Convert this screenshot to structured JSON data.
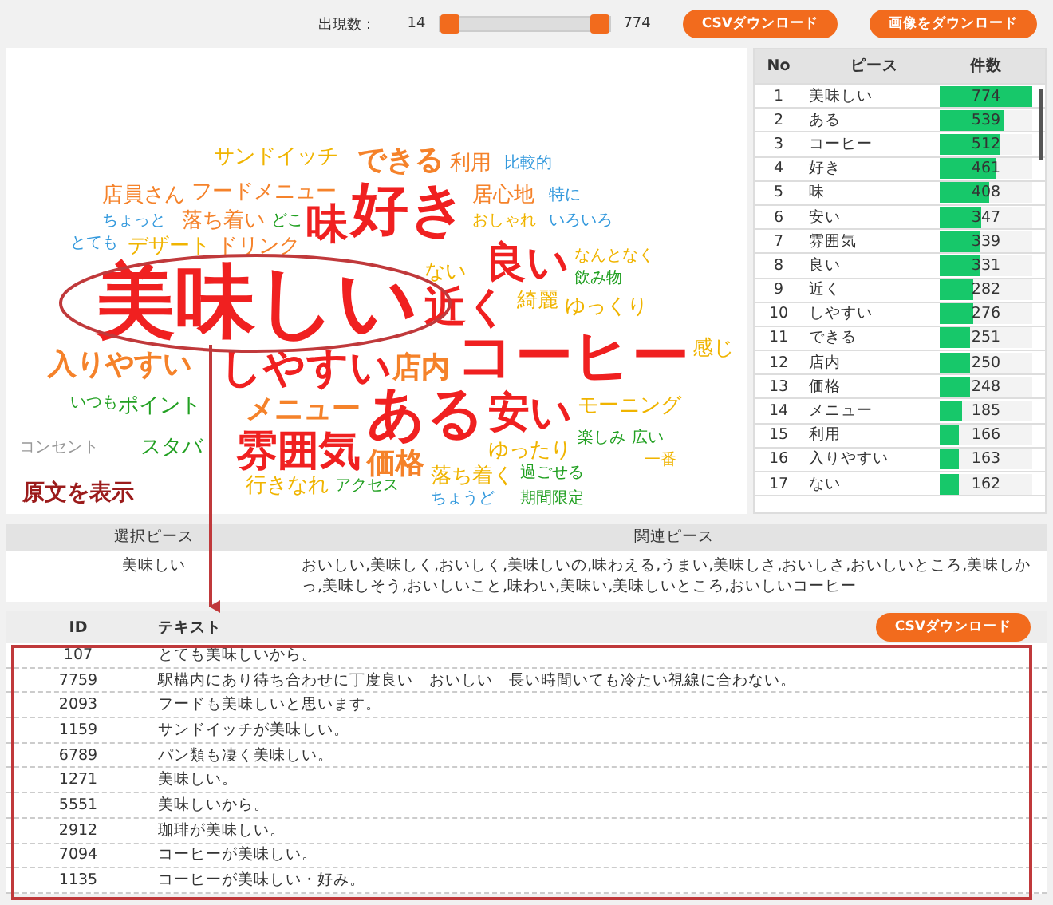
{
  "toolbar": {
    "range_label": "出現数：",
    "min": "14",
    "max": "774",
    "handles": [
      {
        "level": 0
      },
      {
        "level": 1
      }
    ],
    "buttons": [
      "CSVダウンロード",
      "画像をダウンロード"
    ]
  },
  "word_cloud": {
    "words": [
      {
        "text": "サンドイッチ",
        "kind": "small",
        "color": "#f0b400"
      },
      {
        "text": "できる",
        "kind": "medium",
        "color": "#f5822a"
      },
      {
        "text": "利用",
        "kind": "small",
        "color": "#f5822a"
      },
      {
        "text": "比較的",
        "kind": "tiny",
        "color": "#3399dd"
      },
      {
        "text": "店員さん",
        "kind": "small",
        "color": "#f5822a"
      },
      {
        "text": "フードメニュー",
        "kind": "small",
        "color": "#f5822a"
      },
      {
        "text": "好き",
        "kind": "large",
        "color": "#f02020"
      },
      {
        "text": "居心地",
        "kind": "small",
        "color": "#f5822a"
      },
      {
        "text": "特に",
        "kind": "tiny",
        "color": "#3399dd"
      },
      {
        "text": "ちょっと",
        "kind": "tiny",
        "color": "#3399dd"
      },
      {
        "text": "落ち着い",
        "kind": "small",
        "color": "#f5822a"
      },
      {
        "text": "どこ",
        "kind": "tiny",
        "color": "#22a022"
      },
      {
        "text": "味",
        "kind": "big",
        "color": "#f02020"
      },
      {
        "text": "おしゃれ",
        "kind": "tiny",
        "color": "#f0b400"
      },
      {
        "text": "いろいろ",
        "kind": "tiny",
        "color": "#3399dd"
      },
      {
        "text": "とても",
        "kind": "tiny",
        "color": "#3399dd"
      },
      {
        "text": "デザート",
        "kind": "small",
        "color": "#f0b400"
      },
      {
        "text": "ドリンク",
        "kind": "small",
        "color": "#f5822a"
      },
      {
        "text": "良い",
        "kind": "big",
        "color": "#f02020"
      },
      {
        "text": "なんとなく",
        "kind": "tiny",
        "color": "#f0b400"
      },
      {
        "text": "美味しい",
        "kind": "huge",
        "color": "#f02020"
      },
      {
        "text": "ない",
        "kind": "small",
        "color": "#f0b400"
      },
      {
        "text": "飲み物",
        "kind": "tiny",
        "color": "#22a022"
      },
      {
        "text": "近く",
        "kind": "big",
        "color": "#f02020"
      },
      {
        "text": "綺麗",
        "kind": "small",
        "color": "#f0b400"
      },
      {
        "text": "ゆっくり",
        "kind": "small",
        "color": "#f0b400"
      },
      {
        "text": "コーヒー",
        "kind": "large",
        "color": "#f02020"
      },
      {
        "text": "感じ",
        "kind": "small",
        "color": "#f0b400"
      },
      {
        "text": "入りやすい",
        "kind": "medium",
        "color": "#f5822a"
      },
      {
        "text": "しやすい",
        "kind": "big",
        "color": "#f02020"
      },
      {
        "text": "店内",
        "kind": "medium",
        "color": "#f5822a"
      },
      {
        "text": "いつも",
        "kind": "tiny",
        "color": "#22a022"
      },
      {
        "text": "ポイント",
        "kind": "small",
        "color": "#22a022"
      },
      {
        "text": "メニュー",
        "kind": "medium",
        "color": "#f5822a"
      },
      {
        "text": "ある",
        "kind": "large",
        "color": "#f02020"
      },
      {
        "text": "安い",
        "kind": "big",
        "color": "#f02020"
      },
      {
        "text": "モーニング",
        "kind": "small",
        "color": "#f0b400"
      },
      {
        "text": "コンセント",
        "kind": "tiny",
        "color": "#999999"
      },
      {
        "text": "スタバ",
        "kind": "small",
        "color": "#22a022"
      },
      {
        "text": "雰囲気",
        "kind": "big",
        "color": "#f02020"
      },
      {
        "text": "価格",
        "kind": "medium",
        "color": "#f5822a"
      },
      {
        "text": "ゆったり",
        "kind": "small",
        "color": "#f0b400"
      },
      {
        "text": "楽しみ",
        "kind": "tiny",
        "color": "#22a022"
      },
      {
        "text": "広い",
        "kind": "tiny",
        "color": "#22a022"
      },
      {
        "text": "一番",
        "kind": "tiny",
        "color": "#f0b400"
      },
      {
        "text": "行きなれ",
        "kind": "small",
        "color": "#f0b400"
      },
      {
        "text": "アクセス",
        "kind": "tiny",
        "color": "#22a022"
      },
      {
        "text": "落ち着く",
        "kind": "small",
        "color": "#f0b400"
      },
      {
        "text": "過ごせる",
        "kind": "tiny",
        "color": "#22a022"
      },
      {
        "text": "ちょうど",
        "kind": "tiny",
        "color": "#3399dd"
      },
      {
        "text": "期間限定",
        "kind": "tiny",
        "color": "#22a022"
      }
    ]
  },
  "ranking": {
    "columns": [
      "No",
      "ピース",
      "件数"
    ],
    "rows": [
      {
        "no": "1",
        "piece": "美味しい",
        "count": "774",
        "level": 1
      },
      {
        "no": "2",
        "piece": "ある",
        "count": "539",
        "level": 0.696
      },
      {
        "no": "3",
        "piece": "コーヒー",
        "count": "512",
        "level": 0.661
      },
      {
        "no": "4",
        "piece": "好き",
        "count": "461",
        "level": 0.596
      },
      {
        "no": "5",
        "piece": "味",
        "count": "408",
        "level": 0.527
      },
      {
        "no": "6",
        "piece": "安い",
        "count": "347",
        "level": 0.448
      },
      {
        "no": "7",
        "piece": "雰囲気",
        "count": "339",
        "level": 0.438
      },
      {
        "no": "8",
        "piece": "良い",
        "count": "331",
        "level": 0.428
      },
      {
        "no": "9",
        "piece": "近く",
        "count": "282",
        "level": 0.364
      },
      {
        "no": "10",
        "piece": "しやすい",
        "count": "276",
        "level": 0.357
      },
      {
        "no": "11",
        "piece": "できる",
        "count": "251",
        "level": 0.324
      },
      {
        "no": "12",
        "piece": "店内",
        "count": "250",
        "level": 0.323
      },
      {
        "no": "13",
        "piece": "価格",
        "count": "248",
        "level": 0.32
      },
      {
        "no": "14",
        "piece": "メニュー",
        "count": "185",
        "level": 0.239
      },
      {
        "no": "15",
        "piece": "利用",
        "count": "166",
        "level": 0.214
      },
      {
        "no": "16",
        "piece": "入りやすい",
        "count": "163",
        "level": 0.211
      },
      {
        "no": "17",
        "piece": "ない",
        "count": "162",
        "level": 0.209
      }
    ]
  },
  "annotation": {
    "label": "原文を表示"
  },
  "related": {
    "columns": [
      "選択ピース",
      "関連ピース"
    ],
    "selected_piece": "美味しい",
    "related_pieces": "おいしい,美味しく,おいしく,美味しいの,味わえる,うまい,美味しさ,おいしさ,おいしいところ,美味しかっ,美味しそう,おいしいこと,味わい,美味い,美味しいところ,おいしいコーヒー"
  },
  "texts": {
    "columns": [
      "ID",
      "テキスト"
    ],
    "button": "CSVダウンロード",
    "rows": [
      {
        "id": "107",
        "text": "とても美味しいから。"
      },
      {
        "id": "7759",
        "text": "駅構内にあり待ち合わせに丁度良い　おいしい　長い時間いても冷たい視線に合わない。"
      },
      {
        "id": "2093",
        "text": "フードも美味しいと思います。"
      },
      {
        "id": "1159",
        "text": "サンドイッチが美味しい。"
      },
      {
        "id": "6789",
        "text": "パン類も凄く美味しい。"
      },
      {
        "id": "1271",
        "text": "美味しい。"
      },
      {
        "id": "5551",
        "text": "美味しいから。"
      },
      {
        "id": "2912",
        "text": "珈琲が美味しい。"
      },
      {
        "id": "7094",
        "text": "コーヒーが美味しい。"
      },
      {
        "id": "1135",
        "text": "コーヒーが美味しい・好み。"
      }
    ]
  }
}
